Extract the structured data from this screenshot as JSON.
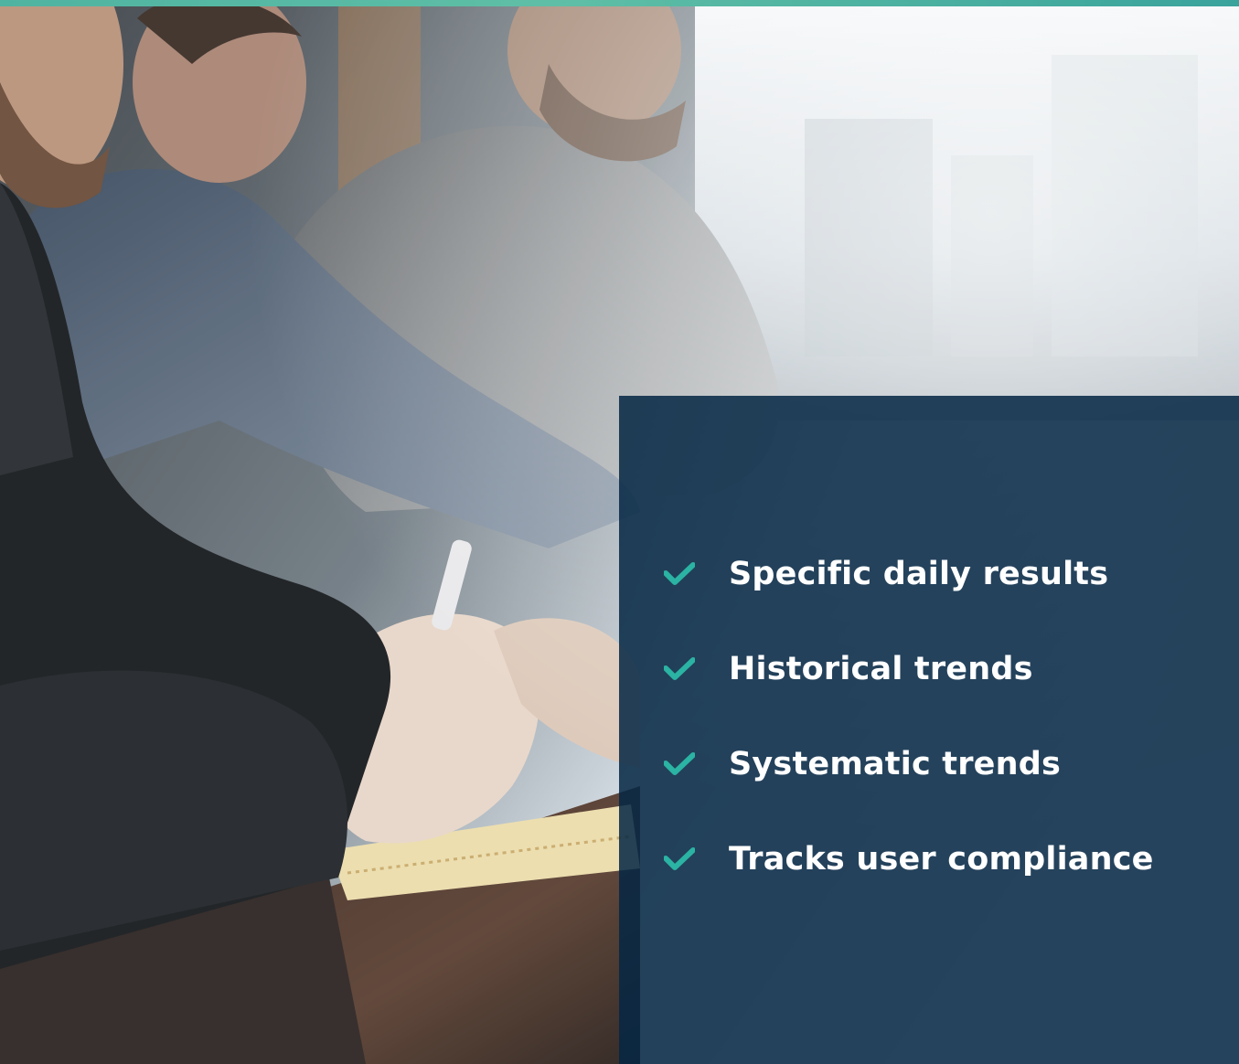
{
  "features": [
    {
      "label": "Specific daily results",
      "icon": "check-icon"
    },
    {
      "label": "Historical trends",
      "icon": "check-icon"
    },
    {
      "label": "Systematic trends",
      "icon": "check-icon"
    },
    {
      "label": "Tracks user compliance",
      "icon": "check-icon"
    }
  ],
  "colors": {
    "accent_bar": "#4fb3a1",
    "panel_background": "#052644",
    "check_mark": "#2bb3a3",
    "feature_text": "#ffffff"
  }
}
